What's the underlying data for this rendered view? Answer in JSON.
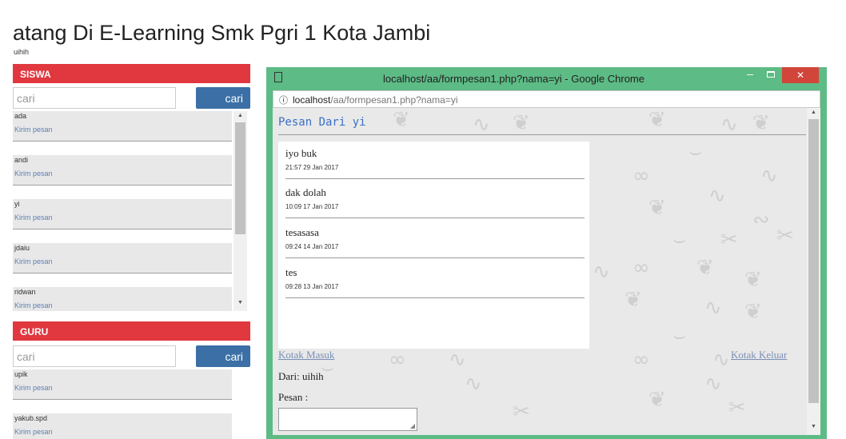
{
  "page": {
    "title": "atang Di E-Learning Smk Pgri 1 Kota Jambi",
    "username": "uihih"
  },
  "siswa": {
    "header": "SISWA",
    "search_placeholder": "cari",
    "search_button": "cari",
    "items": [
      {
        "name": "ada",
        "action": "Kirim pesan"
      },
      {
        "name": "andi",
        "action": "Kirim pesan"
      },
      {
        "name": "yi",
        "action": "Kirim pesan"
      },
      {
        "name": "jdaiu",
        "action": "Kirim pesan"
      },
      {
        "name": "ridwan",
        "action": "Kirim pesan"
      }
    ]
  },
  "guru": {
    "header": "GURU",
    "search_placeholder": "cari",
    "search_button": "cari",
    "items": [
      {
        "name": "upik",
        "action": "Kirim pesan"
      },
      {
        "name": "yakub.spd",
        "action": "Kirim pesan"
      }
    ]
  },
  "popup": {
    "window_title": "localhost/aa/formpesan1.php?nama=yi - Google Chrome",
    "address_host": "localhost",
    "address_path": "/aa/formpesan1.php?nama=yi",
    "close_glyph": "✕",
    "min_glyph": "–",
    "info_glyph": "ⓘ",
    "heading": "Pesan Dari yi",
    "messages": [
      {
        "text": "iyo buk",
        "time": "21:57 29 Jan 2017"
      },
      {
        "text": "dak dolah",
        "time": "10:09 17 Jan 2017"
      },
      {
        "text": "tesasasa",
        "time": "09:24 14 Jan 2017"
      },
      {
        "text": "tes",
        "time": "09:28 13 Jan 2017"
      }
    ],
    "inbox_link": "Kotak Masuk",
    "outbox_link": "Kotak Keluar",
    "from_label": "Dari: uihih",
    "message_label": "Pesan :"
  },
  "icons": {
    "scroll_up": "▲",
    "scroll_down": "▼",
    "resize_grip": "◢"
  },
  "colors": {
    "panel_header": "#e1373f",
    "search_button": "#3b6fa6",
    "window_frame": "#5dbb85",
    "close_button": "#d2453b",
    "link": "#7a8fb5"
  }
}
